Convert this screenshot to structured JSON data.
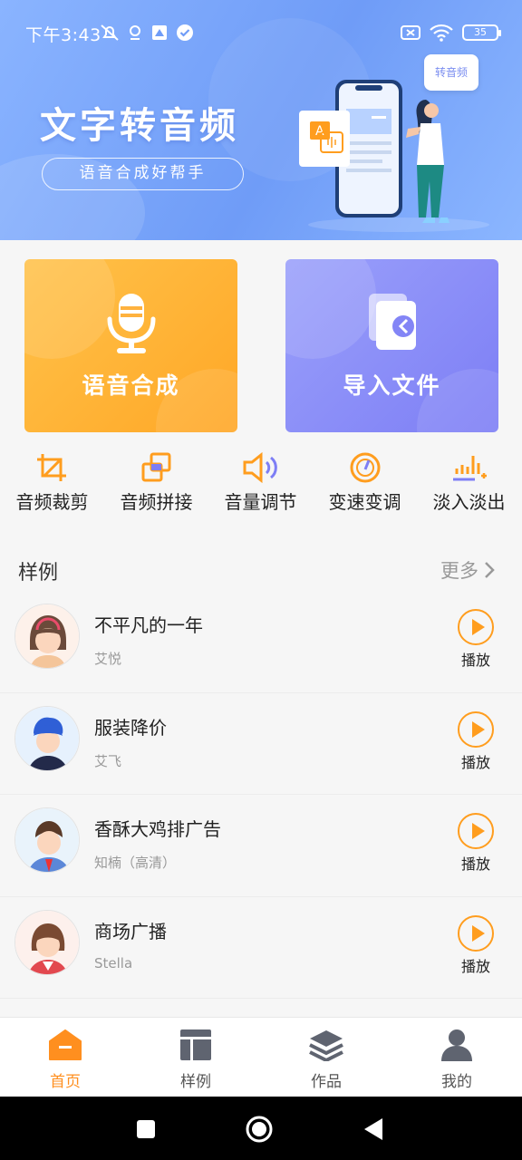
{
  "status_bar": {
    "time": "下午3:43",
    "battery": "35"
  },
  "banner": {
    "title": "文字转音频",
    "subtitle": "语音合成好帮手",
    "bubble_text": "转音频"
  },
  "feature_cards": [
    {
      "label": "语音合成",
      "icon": "microphone-icon",
      "color": "#ffa726"
    },
    {
      "label": "导入文件",
      "icon": "import-file-icon",
      "color": "#7d7ef5"
    }
  ],
  "tools": [
    {
      "label": "音频裁剪",
      "icon": "crop-icon"
    },
    {
      "label": "音频拼接",
      "icon": "splice-icon"
    },
    {
      "label": "音量调节",
      "icon": "volume-icon"
    },
    {
      "label": "变速变调",
      "icon": "speedometer-icon"
    },
    {
      "label": "淡入淡出",
      "icon": "fade-icon"
    }
  ],
  "samples": {
    "title": "样例",
    "more": "更多",
    "items": [
      {
        "title": "不平凡的一年",
        "speaker": "艾悦",
        "action": "播放"
      },
      {
        "title": "服装降价",
        "speaker": "艾飞",
        "action": "播放"
      },
      {
        "title": "香酥大鸡排广告",
        "speaker": "知楠（高清）",
        "action": "播放"
      },
      {
        "title": "商场广播",
        "speaker": "Stella",
        "action": "播放"
      }
    ]
  },
  "tabbar": [
    {
      "label": "首页",
      "icon": "home-icon",
      "active": true
    },
    {
      "label": "样例",
      "icon": "samples-icon",
      "active": false
    },
    {
      "label": "作品",
      "icon": "layers-icon",
      "active": false
    },
    {
      "label": "我的",
      "icon": "user-icon",
      "active": false
    }
  ],
  "accent_color": "#ff9d1e"
}
